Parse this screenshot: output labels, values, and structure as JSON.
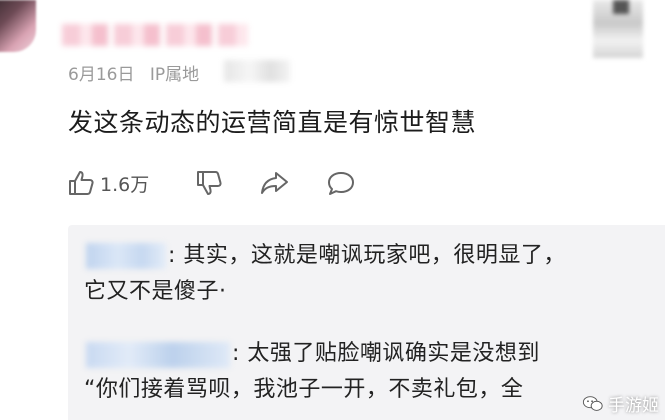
{
  "comment": {
    "date": "6月16日",
    "ip_label": "IP属地",
    "text": "发这条动态的运营简直是有惊世智慧",
    "like_count": "1.6万"
  },
  "actions": {
    "like_icon": "thumbs-up-icon",
    "dislike_icon": "thumbs-down-icon",
    "share_icon": "share-arrow-icon",
    "comment_icon": "comment-bubble-icon"
  },
  "replies": [
    {
      "lines": [
        ": 其实，这就是嘲讽玩家吧，很明显了，",
        "它又不是傻子·"
      ]
    },
    {
      "lines": [
        ": 太强了贴脸嘲讽确实是没想到",
        "“你们接着骂呗，我池子一开，不卖礼包，全"
      ]
    }
  ],
  "watermark": {
    "text": "手游姬",
    "icon": "wechat-icon"
  },
  "colors": {
    "meta_gray": "#9a9a9a",
    "reply_bg": "#f3f3f5",
    "icon_gray": "#666666"
  }
}
